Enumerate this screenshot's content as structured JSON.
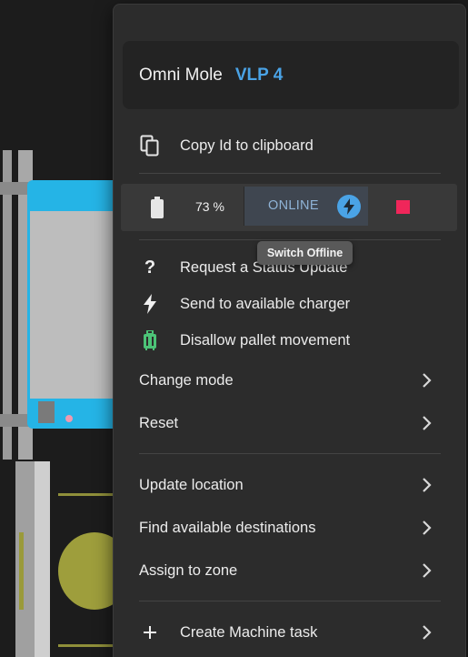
{
  "header": {
    "name": "Omni Mole",
    "tag": "VLP 4"
  },
  "copy_id": {
    "label": "Copy Id to clipboard",
    "icon": "copy-icon"
  },
  "status": {
    "battery_percent": 73,
    "battery_label": "73 %",
    "online_label": "ONLINE",
    "accent_color": "#4aa3e6",
    "stop_color": "#f0265a"
  },
  "tooltip": "Switch Offline",
  "actions": [
    {
      "label": "Request a Status Update",
      "icon": "question-icon"
    },
    {
      "label": "Send to available charger",
      "icon": "lightning-icon"
    },
    {
      "label": "Disallow pallet movement",
      "icon": "luggage-icon",
      "icon_color": "#4cc377"
    }
  ],
  "submenus_a": [
    {
      "label": "Change mode"
    },
    {
      "label": "Reset"
    }
  ],
  "submenus_b": [
    {
      "label": "Update location"
    },
    {
      "label": "Find available destinations"
    },
    {
      "label": "Assign to zone"
    }
  ],
  "create_task": {
    "label": "Create Machine task",
    "icon": "plus-icon"
  }
}
